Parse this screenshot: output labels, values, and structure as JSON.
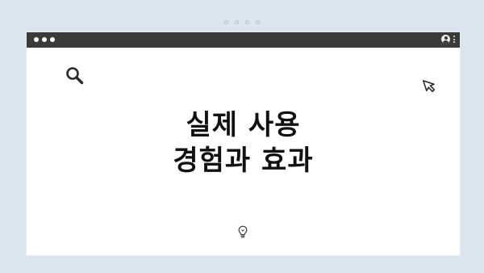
{
  "pager": {
    "dots": 4,
    "color": "#b6c0cc"
  },
  "window": {
    "titlebar_color": "#3a3a3a",
    "icons": [
      "user-icon",
      "kebab-menu-icon"
    ]
  },
  "content": {
    "heading_line1": "실제 사용",
    "heading_line2": "경험과 효과",
    "decorations": [
      "search-icon",
      "cursor-pointer-icon",
      "lightbulb-icon"
    ]
  },
  "colors": {
    "background": "#dce4ee",
    "window_body": "#ffffff",
    "text": "#111111"
  }
}
